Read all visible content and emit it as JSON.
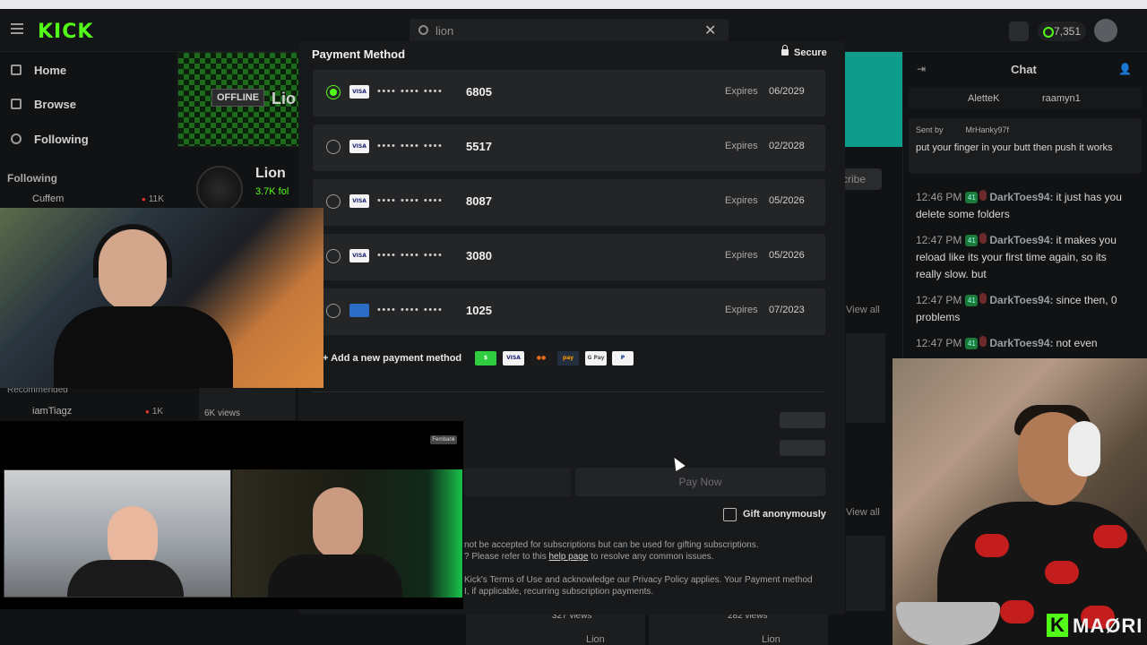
{
  "header": {
    "logo": "KICK",
    "search_value": "lion",
    "search_clear": "✕",
    "points": "7,351"
  },
  "sidebar": {
    "items": [
      {
        "label": "Home",
        "icon": "home-icon"
      },
      {
        "label": "Browse",
        "icon": "browse-icon"
      },
      {
        "label": "Following",
        "icon": "heart-icon"
      }
    ],
    "following_label": "Following",
    "channels": [
      {
        "name": "Cuffem",
        "viewers": "11K"
      },
      {
        "name": "iamTiagz",
        "viewers": "1K"
      }
    ],
    "recommended_label": "Recommended"
  },
  "channel": {
    "offline_badge": "OFFLINE",
    "banner_name": "Lio",
    "name": "Lion",
    "followers": "3.7K fol",
    "subscribe_partial": "cribe",
    "view_all_1": "View all",
    "view_all_2": "View all",
    "views_1": "6K views",
    "views_2": "327 views",
    "views_3": "282 views",
    "bottom_name_1": "Lion",
    "bottom_name_2": "Lion"
  },
  "chat": {
    "title": "Chat",
    "gifters": [
      "AletteK",
      "raamyn1"
    ],
    "pinned_sent_by": "Sent by",
    "pinned_user": "MrHanky97f",
    "pinned_message": "put your finger in your butt then push it works",
    "messages": [
      {
        "time": "12:46 PM",
        "user": "DarkToes94:",
        "text": "it just has you delete some folders"
      },
      {
        "time": "12:47 PM",
        "user": "DarkToes94:",
        "text": "it makes you reload like its your first time again, so its really slow. but"
      },
      {
        "time": "12:47 PM",
        "user": "DarkToes94:",
        "text": "since then, 0 problems"
      },
      {
        "time": "12:47 PM",
        "user": "DarkToes94:",
        "text": "not even"
      }
    ]
  },
  "modal": {
    "title": "Payment Method",
    "secure": "Secure",
    "cards": [
      {
        "brand": "VISA",
        "dots": "•••• •••• ••••",
        "last4": "6805",
        "expires_label": "Expires",
        "expires": "06/2029",
        "selected": true
      },
      {
        "brand": "VISA",
        "dots": "•••• •••• ••••",
        "last4": "5517",
        "expires_label": "Expires",
        "expires": "02/2028",
        "selected": false
      },
      {
        "brand": "VISA",
        "dots": "•••• •••• ••••",
        "last4": "8087",
        "expires_label": "Expires",
        "expires": "05/2026",
        "selected": false
      },
      {
        "brand": "VISA",
        "dots": "•••• •••• ••••",
        "last4": "3080",
        "expires_label": "Expires",
        "expires": "05/2026",
        "selected": false
      },
      {
        "brand": "",
        "dots": "•••• •••• ••••",
        "last4": "1025",
        "expires_label": "Expires",
        "expires": "07/2023",
        "selected": false
      }
    ],
    "add_payment": "+ Add a new payment method",
    "payment_logos": [
      {
        "name": "cashapp-icon",
        "text": "$",
        "bg": "#2fcc40",
        "fg": "#ffffff"
      },
      {
        "name": "visa-icon",
        "text": "VISA",
        "bg": "#f3f3f3",
        "fg": "#1a1f71"
      },
      {
        "name": "mastercard-icon",
        "text": "●●",
        "bg": "#1b1b1b",
        "fg": "#ea6a14"
      },
      {
        "name": "amazonpay-icon",
        "text": "pay",
        "bg": "#232f3e",
        "fg": "#ff9900"
      },
      {
        "name": "googlepay-icon",
        "text": "G Pay",
        "bg": "#f3f3f3",
        "fg": "#555555"
      },
      {
        "name": "paypal-icon",
        "text": "P",
        "bg": "#f3f3f3",
        "fg": "#003087"
      }
    ],
    "pay_now": "Pay Now",
    "gift_anonymously": "Gift anonymously",
    "fine_1": "not be accepted for subscriptions but can be used for gifting subscriptions.",
    "fine_2a": "? Please refer to this ",
    "fine_2_link": "help page",
    "fine_2b": " to resolve any common issues.",
    "fine_3": "Kick's Terms of Use and acknowledge our Privacy Policy applies. Your Payment method",
    "fine_4": "I, if applicable, recurring subscription payments."
  },
  "overlay": {
    "cam_badge": "Fernbank",
    "brand_k": "K",
    "brand_text": "MAØRI"
  },
  "colors": {
    "accent": "#53fc18",
    "modal_bg": "#18191b",
    "row_bg": "#242527"
  }
}
